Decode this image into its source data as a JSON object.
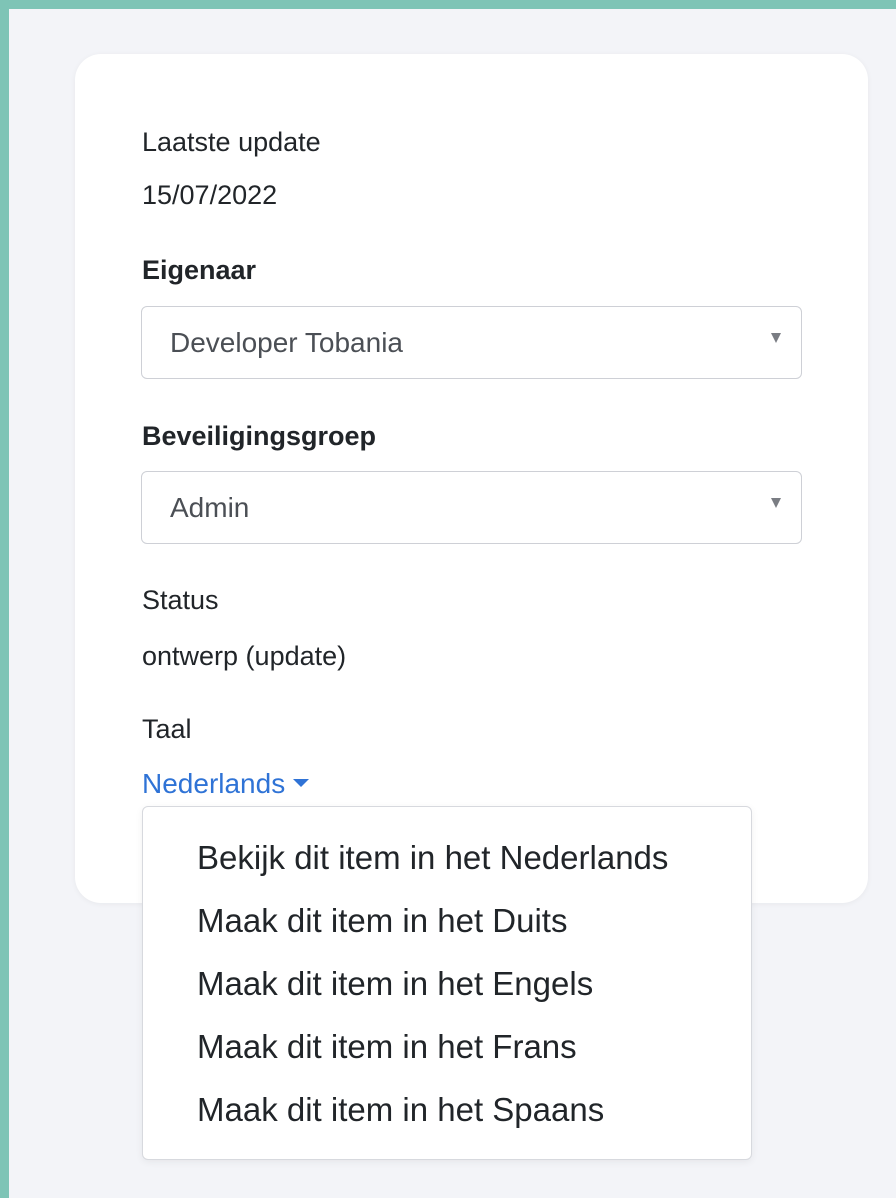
{
  "last_update": {
    "label": "Laatste update",
    "value": "15/07/2022"
  },
  "owner": {
    "label": "Eigenaar",
    "selected": "Developer Tobania",
    "icon": "caret-down-icon"
  },
  "security_group": {
    "label": "Beveiligingsgroep",
    "selected": "Admin",
    "icon": "caret-down-icon"
  },
  "status": {
    "label": "Status",
    "value": "ontwerp (update)"
  },
  "language": {
    "label": "Taal",
    "current": "Nederlands",
    "icon": "caret-down-icon",
    "menu": [
      "Bekijk dit item in het Nederlands",
      "Maak dit item in het Duits",
      "Maak dit item in het Engels",
      "Maak dit item in het Frans",
      "Maak dit item in het Spaans"
    ]
  },
  "colors": {
    "accent_border": "#7ec4b6",
    "link": "#2f73d6",
    "background": "#f3f4f8",
    "card": "#ffffff"
  }
}
